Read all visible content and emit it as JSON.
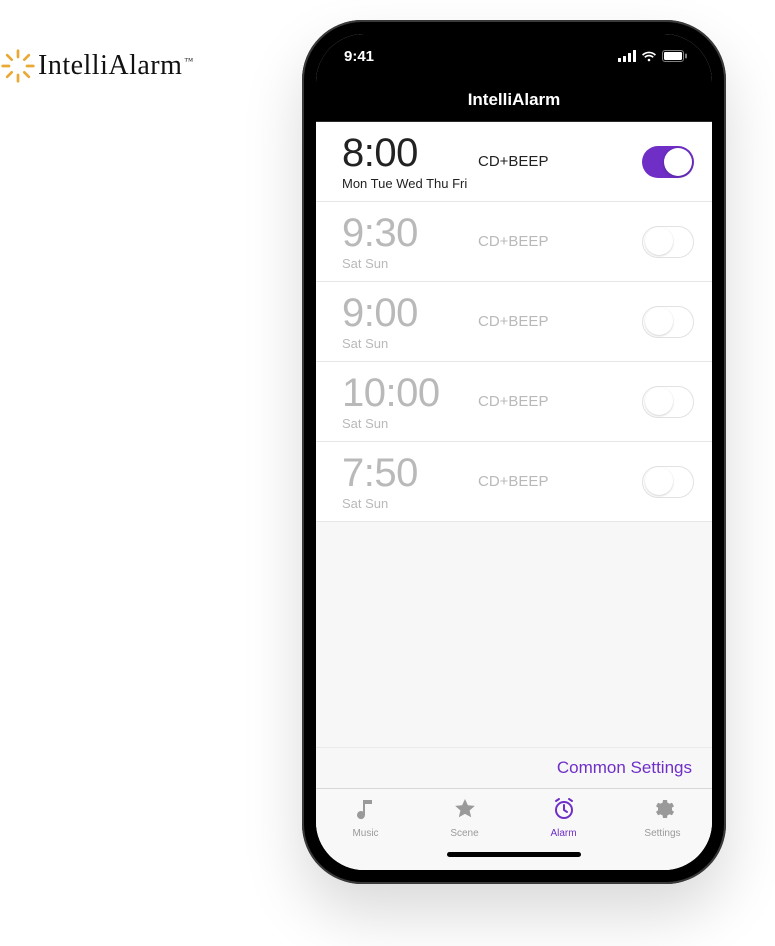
{
  "brand": {
    "name": "IntelliAlarm",
    "trademark": "™"
  },
  "statusbar": {
    "time": "9:41"
  },
  "app": {
    "title": "IntelliAlarm",
    "common_settings_label": "Common Settings"
  },
  "alarms": [
    {
      "time": "8:00",
      "days": "Mon Tue Wed Thu Fri",
      "type": "CD+BEEP",
      "enabled": true
    },
    {
      "time": "9:30",
      "days": "Sat Sun",
      "type": "CD+BEEP",
      "enabled": false
    },
    {
      "time": "9:00",
      "days": "Sat Sun",
      "type": "CD+BEEP",
      "enabled": false
    },
    {
      "time": "10:00",
      "days": "Sat Sun",
      "type": "CD+BEEP",
      "enabled": false
    },
    {
      "time": "7:50",
      "days": "Sat Sun",
      "type": "CD+BEEP",
      "enabled": false
    }
  ],
  "tabs": [
    {
      "id": "music",
      "label": "Music",
      "icon": "music-note-icon",
      "active": false
    },
    {
      "id": "scene",
      "label": "Scene",
      "icon": "star-icon",
      "active": false
    },
    {
      "id": "alarm",
      "label": "Alarm",
      "icon": "alarm-clock-icon",
      "active": true
    },
    {
      "id": "settings",
      "label": "Settings",
      "icon": "gear-icon",
      "active": false
    }
  ],
  "colors": {
    "accent": "#6f2fc7",
    "brand_sun": "#e8a935",
    "inactive_text": "#b9b9b9"
  }
}
